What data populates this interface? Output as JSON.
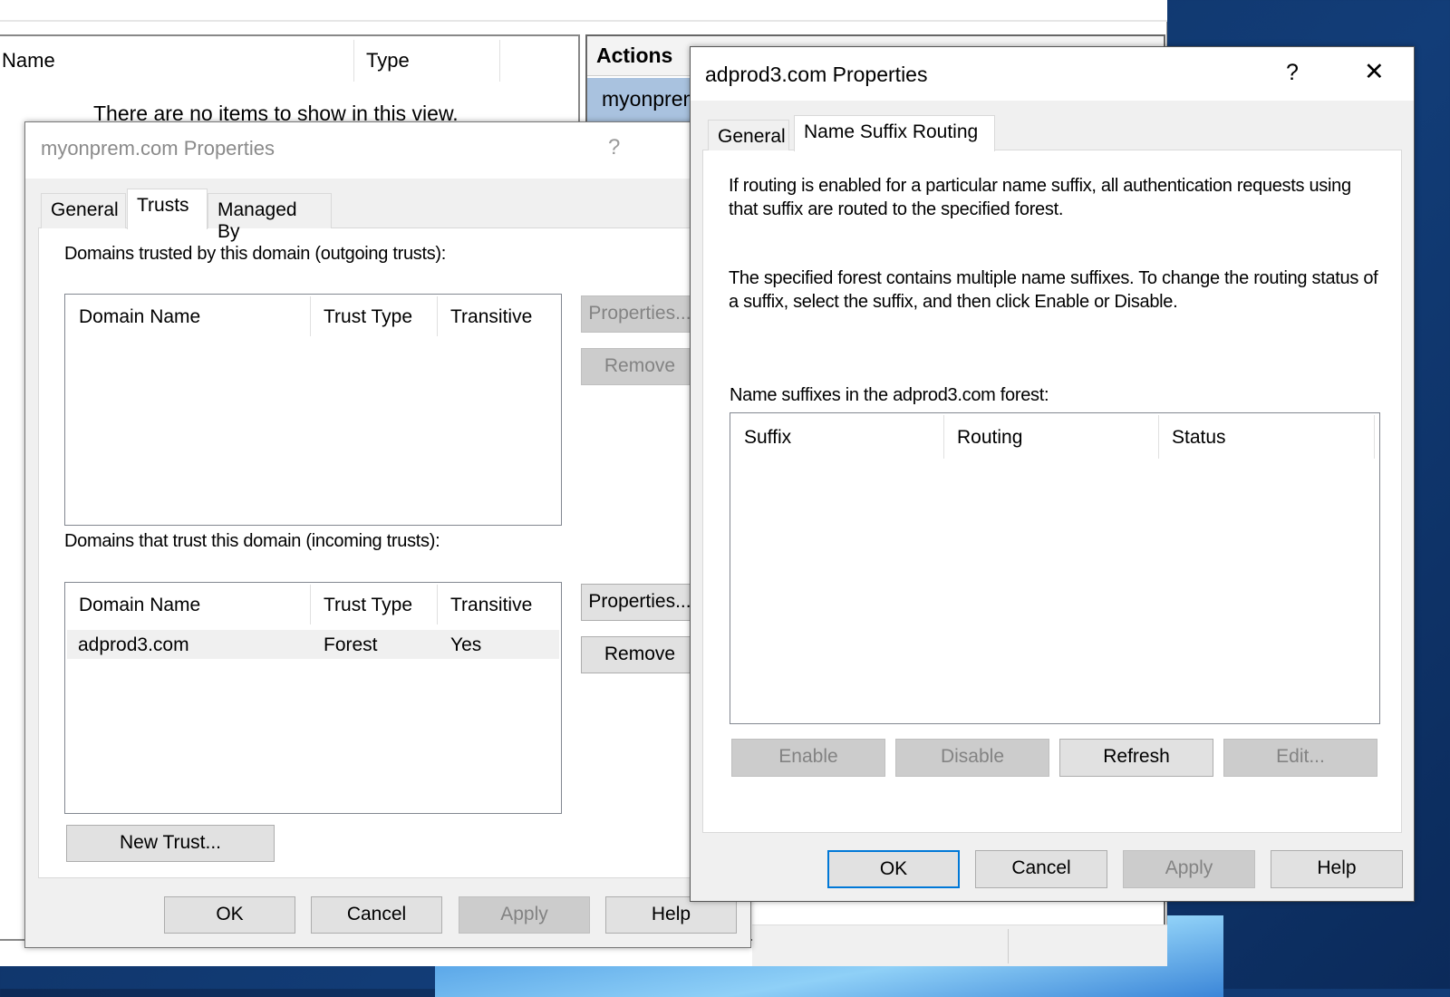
{
  "mmc": {
    "columns": [
      "Name",
      "Type"
    ],
    "empty_text": "There are no items to show in this view.",
    "actions_title": "Actions",
    "actions_item": "myonprem.com"
  },
  "dialog1": {
    "title": "myonprem.com Properties",
    "help": "?",
    "tabs": [
      "General",
      "Trusts",
      "Managed By"
    ],
    "selected_tab": "Trusts",
    "outgoing_label": "Domains trusted by this domain (outgoing trusts):",
    "incoming_label": "Domains that trust this domain (incoming trusts):",
    "columns": [
      "Domain Name",
      "Trust Type",
      "Transitive"
    ],
    "incoming_rows": [
      {
        "domain": "adprod3.com",
        "type": "Forest",
        "transitive": "Yes"
      }
    ],
    "properties": "Properties...",
    "remove": "Remove",
    "new_trust": "New Trust...",
    "ok": "OK",
    "cancel": "Cancel",
    "apply": "Apply",
    "help_btn": "Help"
  },
  "dialog2": {
    "title": "adprod3.com Properties",
    "help": "?",
    "close": "✕",
    "tabs": [
      "General",
      "Name Suffix Routing"
    ],
    "selected_tab": "Name Suffix Routing",
    "desc1": "If routing is enabled for a particular name suffix, all authentication requests using that suffix are routed to the specified forest.",
    "desc2": "The specified forest contains multiple name suffixes. To change the routing status of a suffix, select the suffix, and then click Enable or Disable.",
    "list_label": "Name suffixes in the adprod3.com forest:",
    "columns": [
      "Suffix",
      "Routing",
      "Status"
    ],
    "enable": "Enable",
    "disable": "Disable",
    "refresh": "Refresh",
    "edit": "Edit...",
    "ok": "OK",
    "cancel": "Cancel",
    "apply": "Apply",
    "help_btn": "Help"
  }
}
